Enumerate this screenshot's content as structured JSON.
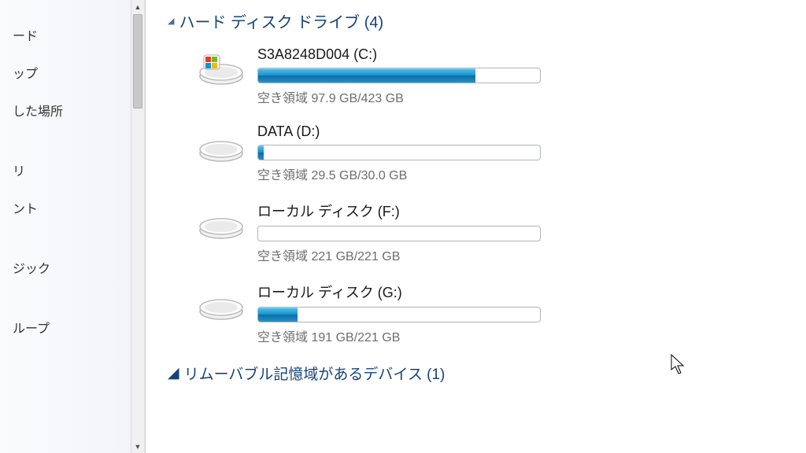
{
  "sidebar": {
    "items": [
      {
        "label": "ード"
      },
      {
        "label": "ップ"
      },
      {
        "label": "した場所"
      },
      {
        "label": "リ"
      },
      {
        "label": "ント"
      },
      {
        "label": "ジック"
      },
      {
        "label": "ループ"
      }
    ]
  },
  "sections": {
    "hdd": {
      "title": "ハード ディスク ドライブ (4)"
    },
    "removable": {
      "title": "リムーバブル記憶域があるデバイス (1)"
    }
  },
  "drives": [
    {
      "label": "S3A8248D004 (C:)",
      "free_text": "空き領域 97.9 GB/423 GB",
      "used_percent": 77,
      "os": true
    },
    {
      "label": "DATA (D:)",
      "free_text": "空き領域 29.5 GB/30.0 GB",
      "used_percent": 2,
      "os": false
    },
    {
      "label": "ローカル ディスク (F:)",
      "free_text": "空き領域 221 GB/221 GB",
      "used_percent": 0,
      "os": false
    },
    {
      "label": "ローカル ディスク (G:)",
      "free_text": "空き領域 191 GB/221 GB",
      "used_percent": 14,
      "os": false
    }
  ]
}
